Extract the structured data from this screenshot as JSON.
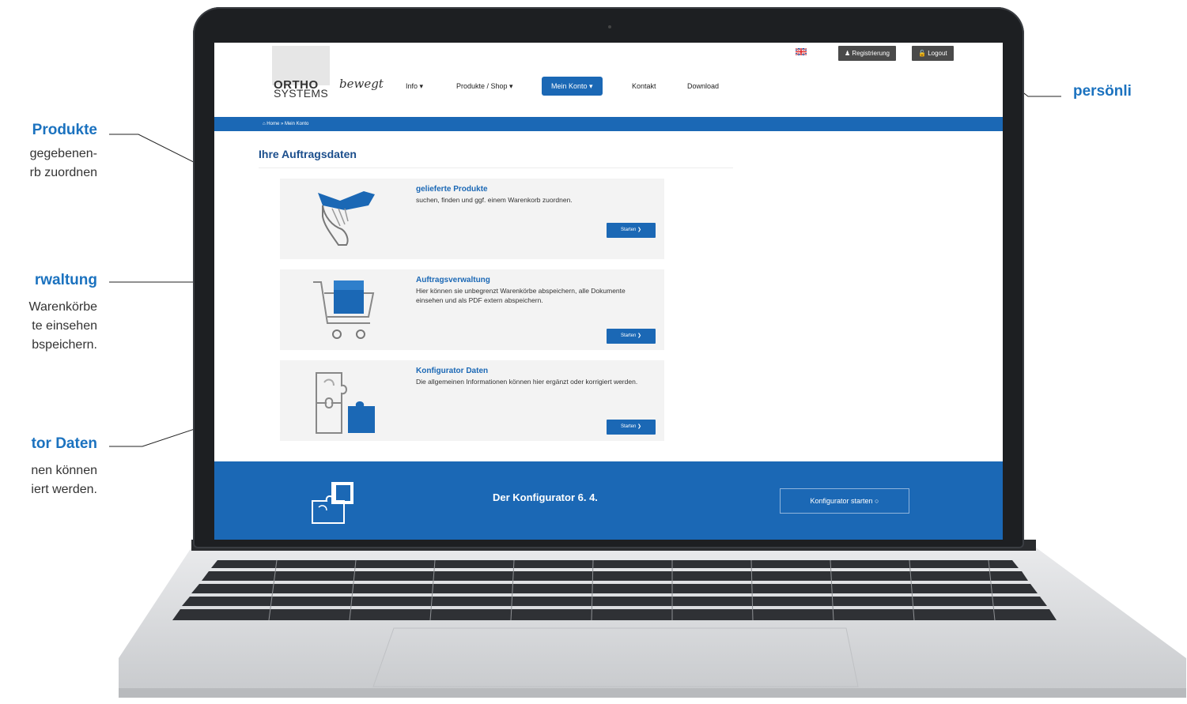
{
  "callouts": {
    "produkte": {
      "title": "Produkte",
      "line1": "gegebenen-",
      "line2": "rb zuordnen"
    },
    "verwaltung": {
      "title": "rwaltung",
      "line1": "Warenkörbe",
      "line2": "te einsehen",
      "line3": "bspeichern."
    },
    "daten": {
      "title": "tor Daten",
      "line1": "nen können",
      "line2": "iert werden."
    },
    "right": {
      "title": "persönli"
    }
  },
  "header": {
    "logo_ortho": "ORTHO",
    "logo_systems": "SYSTEMS",
    "tagline": "bewegt",
    "registrierung": "Registrierung",
    "logout": "Logout"
  },
  "nav": {
    "info": "Info ▾",
    "produkte": "Produkte / Shop ▾",
    "mein_konto": "Mein Konto ▾",
    "kontakt": "Kontakt",
    "download": "Download"
  },
  "breadcrumb": "Home » Mein Konto",
  "page": {
    "title": "Ihre Auftragsdaten"
  },
  "cards": [
    {
      "title": "gelieferte Produkte",
      "desc": "suchen, finden und ggf. einem Warenkorb zuordnen.",
      "button": "Starten ❯"
    },
    {
      "title": "Auftragsverwaltung",
      "desc": "Hier können sie unbegrenzt Warenkörbe abspeichern, alle Dokumente einsehen und als PDF extern abspeichern.",
      "button": "Starten ❯"
    },
    {
      "title": "Konfigurator Daten",
      "desc": "Die allgemeinen Informationen können hier ergänzt oder korrigiert werden.",
      "button": "Starten ❯"
    }
  ],
  "footer": {
    "title": "Der Konfigurator 6. 4.",
    "button": "Konfigurator starten ○"
  },
  "colors": {
    "brand_blue": "#1b68b5",
    "callout_blue": "#1b72bf",
    "logo_green": "#8cc63f"
  }
}
